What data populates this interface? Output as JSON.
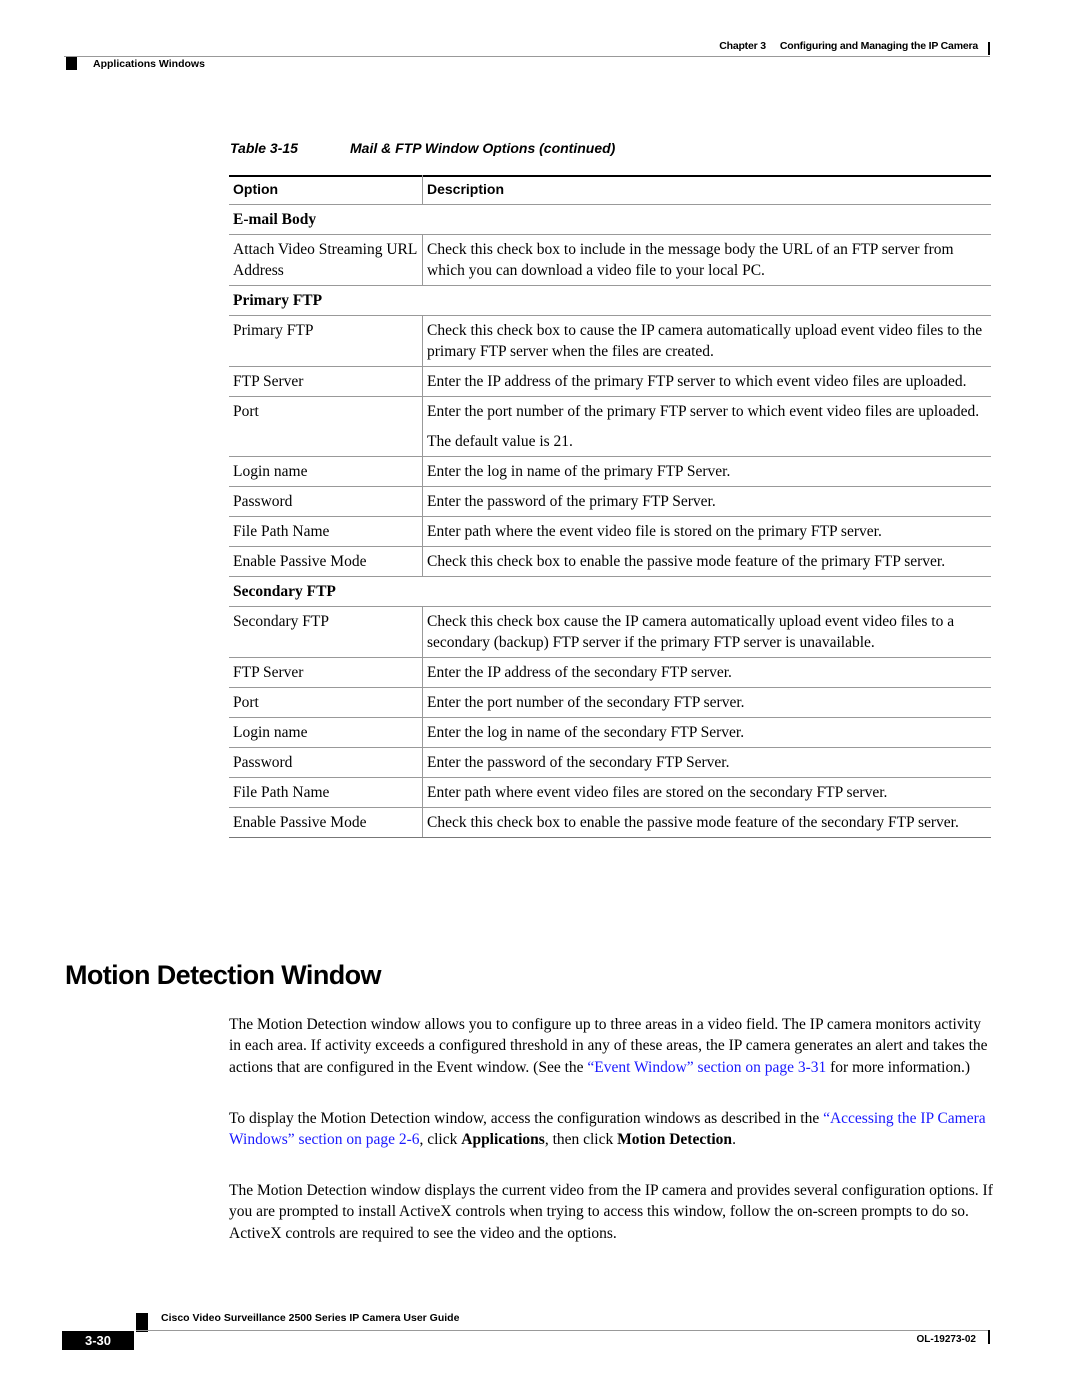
{
  "header": {
    "chapter": "Chapter 3",
    "chapter_title": "Configuring and Managing the IP Camera",
    "section": "Applications Windows"
  },
  "table": {
    "number": "Table 3-15",
    "title": "Mail & FTP Window Options (continued)",
    "columns": [
      "Option",
      "Description"
    ],
    "sections": [
      {
        "title": "E-mail Body",
        "rows": [
          {
            "option": "Attach Video Streaming URL Address",
            "description": [
              "Check this check box to include in the message body the URL of an FTP server from which you can download a video file to your local PC."
            ]
          }
        ]
      },
      {
        "title": "Primary FTP",
        "rows": [
          {
            "option": "Primary FTP",
            "description": [
              "Check this check box to cause the IP camera automatically upload event video files to the primary FTP server when the files are created."
            ]
          },
          {
            "option": "FTP Server",
            "description": [
              "Enter the IP address of the primary FTP server to which event video files are uploaded."
            ]
          },
          {
            "option": "Port",
            "description": [
              "Enter the port number of the primary FTP server to which event video files are uploaded.",
              "The default value is 21."
            ]
          },
          {
            "option": "Login name",
            "description": [
              "Enter the log in name of the primary FTP Server."
            ]
          },
          {
            "option": "Password",
            "description": [
              "Enter the password of the primary FTP Server."
            ]
          },
          {
            "option": "File Path Name",
            "description": [
              "Enter path where the event video file is stored on the primary FTP server."
            ]
          },
          {
            "option": "Enable Passive Mode",
            "description": [
              "Check this check box to enable the passive mode feature of the primary FTP server."
            ]
          }
        ]
      },
      {
        "title": "Secondary FTP",
        "rows": [
          {
            "option": "Secondary FTP",
            "description": [
              "Check this check box cause the IP camera automatically upload event video files to a secondary (backup) FTP server if the primary FTP server is unavailable."
            ]
          },
          {
            "option": "FTP Server",
            "description": [
              "Enter the IP address of the secondary FTP server."
            ]
          },
          {
            "option": "Port",
            "description": [
              "Enter the port number of the secondary FTP server."
            ]
          },
          {
            "option": "Login name",
            "description": [
              "Enter the log in name of the secondary FTP Server."
            ]
          },
          {
            "option": "Password",
            "description": [
              "Enter the password of the secondary FTP Server."
            ]
          },
          {
            "option": "File Path Name",
            "description": [
              "Enter path where event video files are stored on the secondary FTP server."
            ]
          },
          {
            "option": "Enable Passive Mode",
            "description": [
              "Check this check box to enable the passive mode feature of the secondary FTP server."
            ]
          }
        ]
      }
    ]
  },
  "section": {
    "heading": "Motion Detection Window",
    "p1": {
      "text": "The Motion Detection window allows you to configure up to three areas in a video field. The IP camera monitors activity in each area. If activity exceeds a configured threshold in any of these areas, the IP camera generates an alert and takes the actions that are configured in the Event window. (See the ",
      "link": "“Event Window” section on page 3-31",
      "after": " for more information.)"
    },
    "p2": {
      "text": "To display the Motion Detection window, access the configuration windows as described in the ",
      "link": "“Accessing the IP Camera Windows” section on page 2-6",
      "mid1": ", click ",
      "bold1": "Applications",
      "mid2": ", then click ",
      "bold2": "Motion Detection",
      "end": "."
    },
    "p3": {
      "text": "The Motion Detection window displays the current video from the IP camera and provides several configuration options. If you are prompted to install ActiveX controls when trying to access this window, follow the on-screen prompts to do so. ActiveX controls are required to see the video and the options."
    }
  },
  "footer": {
    "guide_title": "Cisco Video Surveillance 2500 Series IP Camera User Guide",
    "page_number": "3-30",
    "doc_number": "OL-19273-02"
  },
  "colors": {
    "link": "#1a1aff",
    "rule": "#999999"
  }
}
